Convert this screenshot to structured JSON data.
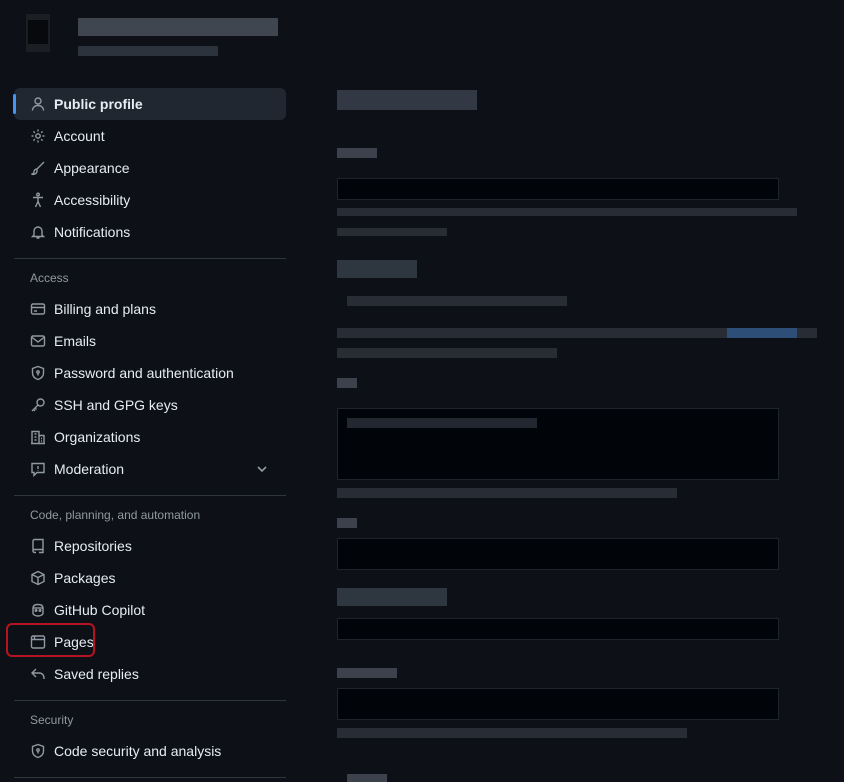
{
  "sidebar": {
    "primary": [
      {
        "label": "Public profile",
        "icon": "person-icon",
        "selected": true
      },
      {
        "label": "Account",
        "icon": "gear-icon"
      },
      {
        "label": "Appearance",
        "icon": "paintbrush-icon"
      },
      {
        "label": "Accessibility",
        "icon": "accessibility-icon"
      },
      {
        "label": "Notifications",
        "icon": "bell-icon"
      }
    ],
    "access_heading": "Access",
    "access": [
      {
        "label": "Billing and plans",
        "icon": "credit-card-icon"
      },
      {
        "label": "Emails",
        "icon": "mail-icon"
      },
      {
        "label": "Password and authentication",
        "icon": "shield-lock-icon"
      },
      {
        "label": "SSH and GPG keys",
        "icon": "key-icon"
      },
      {
        "label": "Organizations",
        "icon": "organization-icon"
      },
      {
        "label": "Moderation",
        "icon": "report-icon"
      }
    ],
    "code_heading": "Code, planning, and automation",
    "code": [
      {
        "label": "Repositories",
        "icon": "repo-icon"
      },
      {
        "label": "Packages",
        "icon": "package-icon"
      },
      {
        "label": "GitHub Copilot",
        "icon": "copilot-icon"
      },
      {
        "label": "Pages",
        "icon": "browser-icon",
        "highlighted": true
      },
      {
        "label": "Saved replies",
        "icon": "reply-icon"
      }
    ],
    "security_heading": "Security",
    "security": [
      {
        "label": "Code security and analysis",
        "icon": "shield-lock-icon"
      }
    ]
  },
  "colors": {
    "background": "#0d1117",
    "selected_bg": "#202731",
    "accent": "#4493f8",
    "highlight_border": "#b3141f",
    "muted_text": "#9198a1"
  }
}
